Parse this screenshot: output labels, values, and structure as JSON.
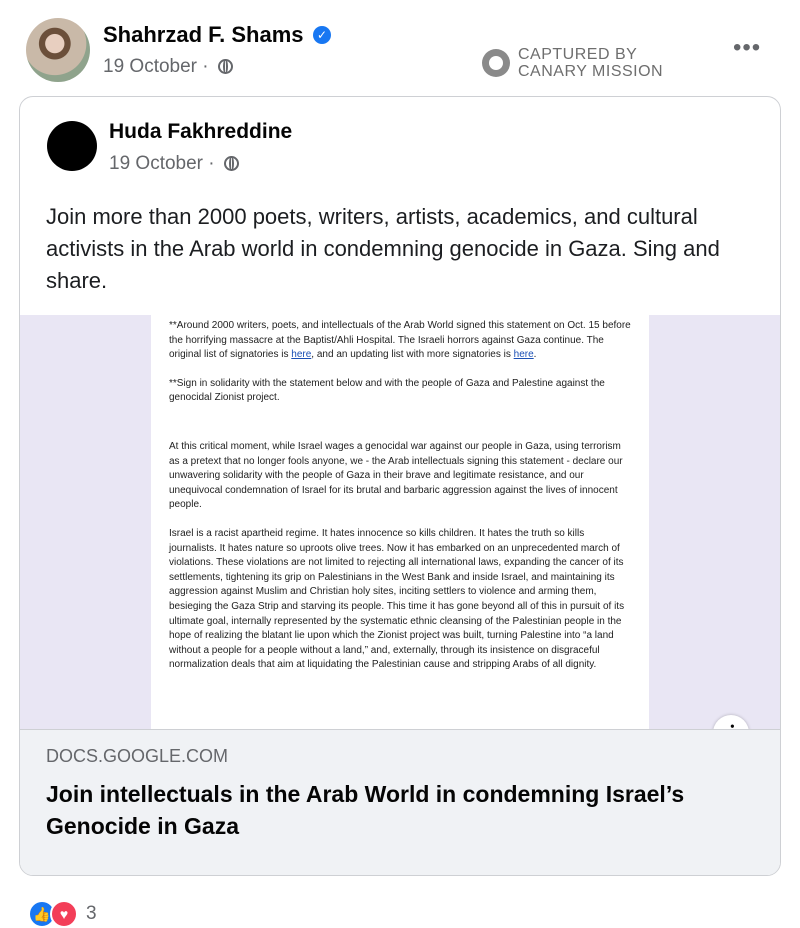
{
  "post": {
    "author": "Shahrzad F. Shams",
    "date": "19 October",
    "separator": "·",
    "watermark": [
      "CAPTURED BY",
      "CANARY MISSION"
    ],
    "more_icon": "•••"
  },
  "shared": {
    "author": "Huda Fakhreddine",
    "date": "19 October",
    "separator": "·",
    "text": "Join more than 2000 poets, writers, artists, academics, and cultural activists in the Arab world in condemning genocide in Gaza. Sing and share."
  },
  "doc": {
    "p1_before": "**Around 2000 writers, poets, and intellectuals of the Arab World signed this statement on Oct. 15 before the horrifying massacre at the Baptist/Ahli Hospital. The Israeli horrors against Gaza continue. The original list of signatories is ",
    "p1_link1": "here",
    "p1_mid": ", and an updating list with more signatories is ",
    "p1_link2": "here",
    "p1_end": ".",
    "p2": "**Sign in solidarity with the statement below and with the people of Gaza and Palestine against the genocidal Zionist project.",
    "p3": "At this critical moment, while Israel wages a genocidal war against our people in Gaza, using terrorism as a pretext that no longer fools anyone, we - the Arab intellectuals signing this statement - declare our unwavering solidarity with the people of Gaza in their brave and legitimate resistance, and our unequivocal condemnation of Israel for its brutal and barbaric aggression against the lives of innocent people.",
    "p4": "Israel is a racist apartheid regime. It hates innocence so kills children. It hates the truth so kills journalists. It hates nature so uproots olive trees. Now it has embarked on an unprecedented march of violations. These violations are not limited to rejecting all international laws, expanding the cancer of its settlements, tightening its grip on Palestinians in the West Bank and inside Israel, and maintaining its aggression against Muslim and Christian holy sites, inciting settlers to violence and arming them, besieging the Gaza Strip and starving its people. This time it has gone beyond all of this in pursuit of its ultimate goal, internally represented by the systematic ethnic cleansing of the Palestinian people in the hope of realizing the blatant lie upon which the Zionist project was built, turning Palestine into “a land without a people for a people without a land,” and, externally, through its insistence on disgraceful normalization deals that aim at liquidating the Palestinian cause and stripping Arabs of all dignity."
  },
  "link": {
    "domain": "DOCS.GOOGLE.COM",
    "title": "Join intellectuals in the Arab World in condemning Israel’s Genocide in Gaza",
    "info_icon": "i"
  },
  "reactions": {
    "count": "3",
    "like_icon": "👍",
    "love_icon": "♥"
  }
}
